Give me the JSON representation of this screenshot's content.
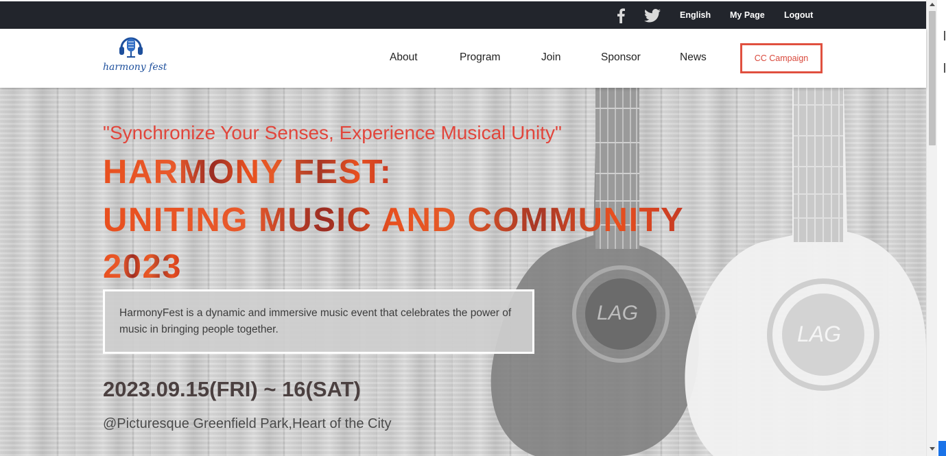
{
  "topbar": {
    "social": [
      {
        "name": "facebook-icon"
      },
      {
        "name": "twitter-icon"
      }
    ],
    "language": "English",
    "my_page": "My Page",
    "logout": "Logout"
  },
  "header": {
    "logo_text": "harmony fest",
    "nav": [
      "About",
      "Program",
      "Join",
      "Sponsor",
      "News"
    ],
    "cta": "CC Campaign"
  },
  "hero": {
    "tagline": "\"Synchronize Your Senses, Experience Musical Unity\"",
    "headline_lines": [
      "HARMONY FEST:",
      "UNITING MUSIC AND COMMUNITY",
      "2023"
    ],
    "description": "HarmonyFest is a dynamic and immersive music event that celebrates the power of music in bringing people together.",
    "date": "2023.09.15(FRI) ~ 16(SAT)",
    "venue": "@Picturesque Greenfield Park,Heart of the City"
  },
  "colors": {
    "topbar_bg": "#22252c",
    "accent_red": "#e1463c",
    "headline_orange": "#e8501f",
    "logo_blue": "#1d4f9c"
  }
}
